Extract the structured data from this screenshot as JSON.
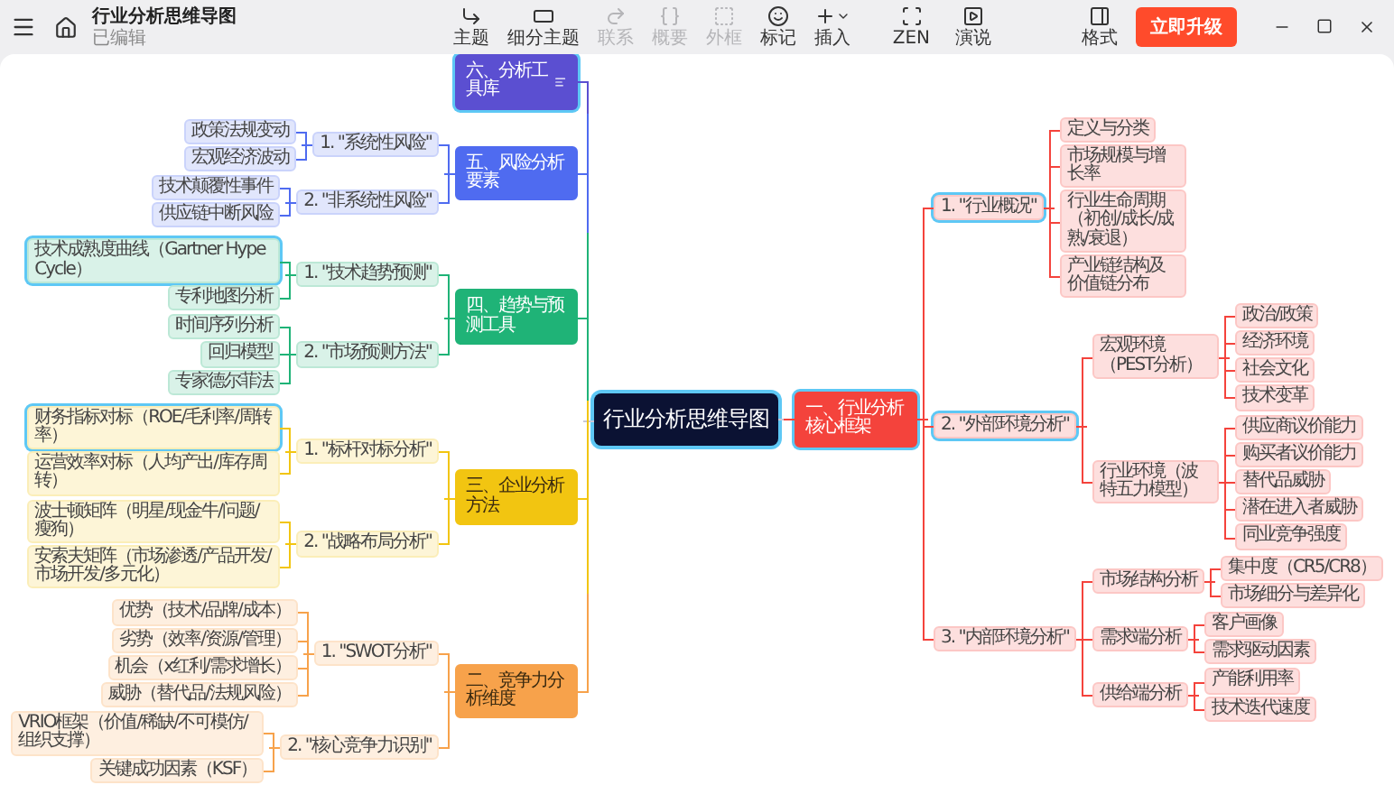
{
  "window": {
    "title": "行业分析思维导图",
    "status": "已编辑"
  },
  "tools": [
    {
      "label": "主题",
      "disabled": false
    },
    {
      "label": "细分主题",
      "disabled": false
    },
    {
      "label": "联系",
      "disabled": true
    },
    {
      "label": "概要",
      "disabled": true
    },
    {
      "label": "外框",
      "disabled": true
    },
    {
      "label": "标记",
      "disabled": false
    },
    {
      "label": "插入",
      "disabled": false
    }
  ],
  "view_tools": [
    {
      "label": "ZEN"
    },
    {
      "label": "演说"
    }
  ],
  "format_tool": {
    "label": "格式"
  },
  "upgrade_button": {
    "label": "立即升级"
  },
  "root": {
    "label": "行业分析思维导图",
    "selected": true
  },
  "left_branches": [
    {
      "label": "六、分析工具库",
      "color": "#5b4fd1",
      "note": true,
      "selected": true
    },
    {
      "label": "五、风险分析要素",
      "color": "#4f6bf0",
      "note": false,
      "selected": false,
      "children": [
        {
          "label": "1. \"系统性风险\"",
          "selected": false,
          "children": [
            {
              "label": "政策法规变动",
              "selected": false
            },
            {
              "label": "宏观经济波动",
              "selected": false
            }
          ]
        },
        {
          "label": "2. \"非系统性风险\"",
          "selected": false,
          "children": [
            {
              "label": "技术颠覆性事件",
              "selected": false
            },
            {
              "label": "供应链中断风险",
              "selected": false
            }
          ]
        }
      ]
    },
    {
      "label": "四、趋势与预测工具",
      "color": "#1fb377",
      "note": false,
      "selected": false,
      "children": [
        {
          "label": "1. \"技术趋势预测\"",
          "selected": false,
          "children": [
            {
              "label": "技术成熟度曲线（Gartner Hype Cycle）",
              "selected": true
            },
            {
              "label": "专利地图分析",
              "selected": false
            }
          ]
        },
        {
          "label": "2. \"市场预测方法\"",
          "selected": false,
          "children": [
            {
              "label": "时间序列分析",
              "selected": false
            },
            {
              "label": "回归模型",
              "selected": false
            },
            {
              "label": "专家德尔菲法",
              "selected": false
            }
          ]
        }
      ]
    },
    {
      "label": "三、企业分析方法",
      "color": "#f2c511",
      "note": false,
      "selected": false,
      "children": [
        {
          "label": "1. \"标杆对标分析\"",
          "selected": false,
          "children": [
            {
              "label": "财务指标对标（ROE/毛利率/周转率）",
              "selected": true
            },
            {
              "label": "运营效率对标（人均产出/库存周转）",
              "selected": false
            }
          ]
        },
        {
          "label": "2. \"战略布局分析\"",
          "selected": false,
          "children": [
            {
              "label": "波士顿矩阵（明星/现金牛/问题/瘦狗）",
              "selected": false
            },
            {
              "label": "安索夫矩阵（市场渗透/产品开发/市场开发/多元化）",
              "selected": false
            }
          ]
        }
      ]
    },
    {
      "label": "二、竞争力分析维度",
      "color": "#f7a24b",
      "note": false,
      "selected": false,
      "children": [
        {
          "label": "1. \"SWOT分析\"",
          "selected": false,
          "children": [
            {
              "label": "优势（技术/品牌/成本）",
              "selected": false
            },
            {
              "label": "劣势（效率/资源/管理）",
              "selected": false
            },
            {
              "label": "机会（x红利/需求增长）",
              "selected": false
            },
            {
              "label": "威胁（替代品/法规风险）",
              "selected": false
            }
          ]
        },
        {
          "label": "2. \"核心竞争力识别\"",
          "selected": false,
          "children": [
            {
              "label": "VRIO框架（价值/稀缺/不可模仿/组织支撑）",
              "selected": false
            },
            {
              "label": "关键成功因素（KSF）",
              "selected": false
            }
          ]
        }
      ]
    }
  ],
  "right_branches": [
    {
      "label": "一、行业分析核心框架",
      "color": "#f4433c",
      "note": false,
      "selected": true,
      "children": [
        {
          "label": "1. \"行业概况\"",
          "selected": true,
          "children": [
            {
              "label": "定义与分类",
              "selected": false
            },
            {
              "label": "市场规模与增长率",
              "selected": false
            },
            {
              "label": "行业生命周期（初创/成长/成熟/衰退）",
              "selected": false
            },
            {
              "label": "产业链结构及价值链分布",
              "selected": false
            }
          ]
        },
        {
          "label": "2. \"外部环境分析\"",
          "selected": true,
          "children": [
            {
              "label": "宏观环境（PEST分析）",
              "selected": false,
              "children": [
                {
                  "label": "政治/政策",
                  "selected": false
                },
                {
                  "label": "经济环境",
                  "selected": false
                },
                {
                  "label": "社会文化",
                  "selected": false
                },
                {
                  "label": "技术变革",
                  "selected": false
                }
              ]
            },
            {
              "label": "行业环境（波特五力模型）",
              "selected": false,
              "children": [
                {
                  "label": "供应商议价能力",
                  "selected": false
                },
                {
                  "label": "购买者议价能力",
                  "selected": false
                },
                {
                  "label": "替代品威胁",
                  "selected": false
                },
                {
                  "label": "潜在进入者威胁",
                  "selected": false
                },
                {
                  "label": "同业竞争强度",
                  "selected": false
                }
              ]
            }
          ]
        },
        {
          "label": "3. \"内部环境分析\"",
          "selected": false,
          "children": [
            {
              "label": "市场结构分析",
              "selected": false,
              "children": [
                {
                  "label": "集中度（CR5/CR8）",
                  "selected": false
                },
                {
                  "label": "市场细分与差异化",
                  "selected": false
                }
              ]
            },
            {
              "label": "需求端分析",
              "selected": false,
              "children": [
                {
                  "label": "客户画像",
                  "selected": false
                },
                {
                  "label": "需求驱动因素",
                  "selected": false
                }
              ]
            },
            {
              "label": "供给端分析",
              "selected": false,
              "children": [
                {
                  "label": "产能利用率",
                  "selected": false
                },
                {
                  "label": "技术迭代速度",
                  "selected": false
                }
              ]
            }
          ]
        }
      ]
    }
  ]
}
